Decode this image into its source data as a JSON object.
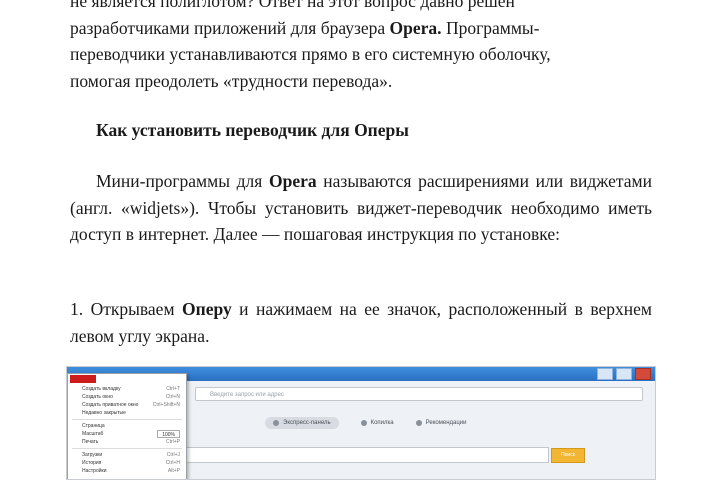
{
  "document": {
    "para1": {
      "line1": "не является полиглотом? Ответ на этот вопрос давно решен",
      "line2_pre": "разработчиками приложений для браузера ",
      "line2_bold": "Opera.",
      "line2_post": " Программы-",
      "line3": "переводчики  устанавливаются прямо в его системную оболочку,",
      "line4": "помогая преодолеть «трудности перевода»."
    },
    "heading": "Как установить переводчик для Оперы",
    "para2": {
      "pre": "Мини-программы для ",
      "bold": "Opera",
      "post": " называются расширениями или виджетами (англ. «widjets»). Чтобы установить виджет-переводчик необходимо иметь доступ в интернет. Далее — пошаговая инструкция по установке:"
    },
    "para3": {
      "pre": "1. Открываем ",
      "bold": "Оперу",
      "post": " и нажимаем на ее значок, расположенный в верхнем левом углу экрана."
    }
  },
  "screenshot": {
    "address_placeholder": "Введите запрос или адрес",
    "tabs": [
      "Экспресс-панель",
      "Копилка",
      "Рекомендации"
    ],
    "search_button": "Поиск",
    "menu": {
      "items": [
        {
          "label": "Создать вкладку",
          "shortcut": "Ctrl+T"
        },
        {
          "label": "Создать окно",
          "shortcut": "Ctrl+N"
        },
        {
          "label": "Создать приватное окно",
          "shortcut": "Ctrl+Shift+N"
        },
        {
          "label": "Недавно закрытые",
          "shortcut": ""
        }
      ],
      "page_label": "Страница",
      "zoom_label": "Масштаб",
      "zoom_value": "100%",
      "print_label": "Печать",
      "print_shortcut": "Ctrl+P",
      "lower_items": [
        {
          "label": "Загрузки",
          "shortcut": "Ctrl+J"
        },
        {
          "label": "История",
          "shortcut": "Ctrl+H"
        },
        {
          "label": "Настройки",
          "shortcut": "Alt+P"
        }
      ]
    },
    "colors": {
      "titlebar": "#2a6fc2",
      "opera_red": "#cc1c1c",
      "search_button": "#f2b632"
    }
  }
}
